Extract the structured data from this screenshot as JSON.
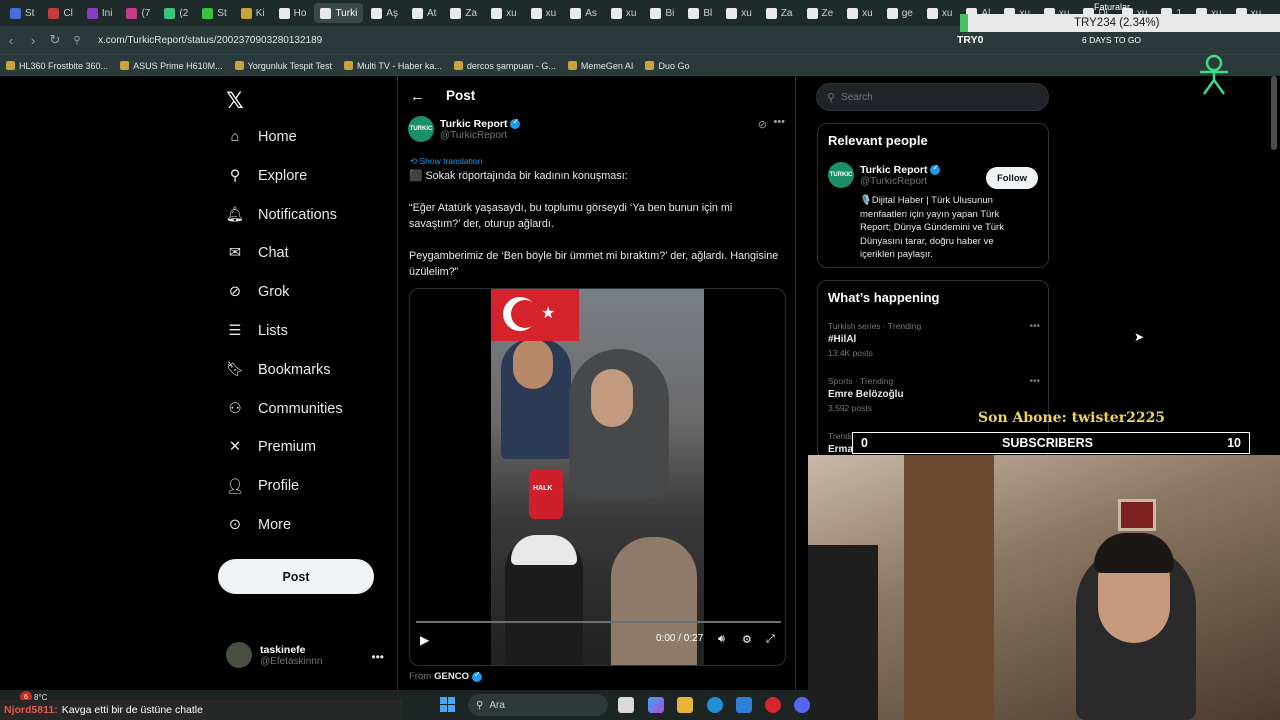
{
  "browser": {
    "tabs": [
      {
        "label": "St",
        "color": "#4a6cd4"
      },
      {
        "label": "Cl",
        "color": "#c43b3b"
      },
      {
        "label": "Ini",
        "color": "#8a3bc4"
      },
      {
        "label": "(7",
        "color": "#c43b8a"
      },
      {
        "label": "(2",
        "color": "#3bc47a"
      },
      {
        "label": "St",
        "color": "#3bc43b"
      },
      {
        "label": "Ki",
        "color": "#c4a43b"
      },
      {
        "label": "Ho",
        "color": "#e7e9ea"
      },
      {
        "label": "Turki",
        "color": "#e7e9ea"
      },
      {
        "label": "Aş",
        "color": "#e7e9ea"
      },
      {
        "label": "At",
        "color": "#e7e9ea"
      },
      {
        "label": "Za",
        "color": "#e7e9ea"
      },
      {
        "label": "xu",
        "color": "#e7e9ea"
      },
      {
        "label": "xu",
        "color": "#e7e9ea"
      },
      {
        "label": "As",
        "color": "#e7e9ea"
      },
      {
        "label": "xu",
        "color": "#e7e9ea"
      },
      {
        "label": "Bi",
        "color": "#e7e9ea"
      },
      {
        "label": "Bl",
        "color": "#e7e9ea"
      },
      {
        "label": "xu",
        "color": "#e7e9ea"
      },
      {
        "label": "Za",
        "color": "#e7e9ea"
      },
      {
        "label": "Ze",
        "color": "#e7e9ea"
      },
      {
        "label": "xu",
        "color": "#e7e9ea"
      },
      {
        "label": "ge",
        "color": "#e7e9ea"
      },
      {
        "label": "xu",
        "color": "#e7e9ea"
      },
      {
        "label": "Al",
        "color": "#e7e9ea"
      },
      {
        "label": "xu",
        "color": "#e7e9ea"
      },
      {
        "label": "xu",
        "color": "#e7e9ea"
      },
      {
        "label": "Di",
        "color": "#e7e9ea"
      },
      {
        "label": "xu",
        "color": "#e7e9ea"
      },
      {
        "label": "1",
        "color": "#e7e9ea"
      },
      {
        "label": "xu",
        "color": "#e7e9ea"
      },
      {
        "label": "xu",
        "color": "#e7e9ea"
      }
    ],
    "url": "x.com/TurkicReport/status/2002370903280132189",
    "bookmarks": [
      "HL360 Frostbite 360...",
      "ASUS Prime H610M...",
      "Yorgunluk Tespit Test",
      "Multi TV - Haber ka...",
      "dercos şampuan - G...",
      "MemeGen AI",
      "Duo Go"
    ]
  },
  "nav": {
    "items": [
      {
        "label": "Home",
        "icon": "home-icon"
      },
      {
        "label": "Explore",
        "icon": "search-icon"
      },
      {
        "label": "Notifications",
        "icon": "bell-icon"
      },
      {
        "label": "Chat",
        "icon": "mail-icon"
      },
      {
        "label": "Grok",
        "icon": "grok-icon"
      },
      {
        "label": "Lists",
        "icon": "list-icon"
      },
      {
        "label": "Bookmarks",
        "icon": "bookmark-icon"
      },
      {
        "label": "Communities",
        "icon": "people-icon"
      },
      {
        "label": "Premium",
        "icon": "x-icon"
      },
      {
        "label": "Profile",
        "icon": "person-icon"
      },
      {
        "label": "More",
        "icon": "more-circle-icon"
      }
    ],
    "post_button": "Post",
    "account": {
      "name": "taskinefe",
      "handle": "@Efetaskinnn"
    }
  },
  "post": {
    "header_title": "Post",
    "author_name": "Turkic Report",
    "author_handle": "@TurkicReport",
    "avatar_text": "TURKIC",
    "show_translation": "Show translation",
    "lines": [
      "⬛ Sokak röportajında bir kadının konuşması:",
      "“Eğer Atatürk yaşasaydı, bu toplumu görseydi ‘Ya ben bunun için mi savaştım?’ der, oturup ağlardı.",
      "Peygamberimiz de ‘Ben böyle bir ümmet mi bıraktım?’ der, ağlardı. Hangisine üzülelim?”"
    ],
    "video_time": "0:00 / 0:27",
    "video_progress": 0,
    "mic_label": "HALK",
    "from_label": "From",
    "from_name": "GENCO"
  },
  "right": {
    "search_placeholder": "Search",
    "relevant_title": "Relevant people",
    "relevant_name": "Turkic Report",
    "relevant_handle": "@TurkicReport",
    "follow_label": "Follow",
    "bio": "🎙️Dijital Haber | Türk Ulusunun menfaatleri için yayın yapan Türk Report; Dünya Gündemini ve Türk Dünyasını tarar, doğru haber ve içerikleri paylaşır.",
    "happening_title": "What’s happening",
    "trends": [
      {
        "category": "Turkish series · Trending",
        "title": "#HilAl",
        "count": "13.4K posts"
      },
      {
        "category": "Sports · Trending",
        "title": "Emre Belözoğlu",
        "count": "3,592 posts"
      },
      {
        "category": "Trending in Turkey",
        "title": "Erman",
        "count": ""
      }
    ]
  },
  "overlay": {
    "ticker": "TRY234 (2.34%)",
    "tryo": "TRY0",
    "days": "6 DAYS TO GO",
    "faturalar": "Faturalar",
    "son_abone": "Son Abone: twister2225",
    "subs_left": "0",
    "subs_label": "SUBSCRIBERS",
    "subs_right": "10"
  },
  "taskbar": {
    "weather": "8°C",
    "notif_count": "6",
    "chat_user": "Njord5811:",
    "chat_msg": "Kavga etti bir de üstüne chatle",
    "search_label": "Ara"
  }
}
